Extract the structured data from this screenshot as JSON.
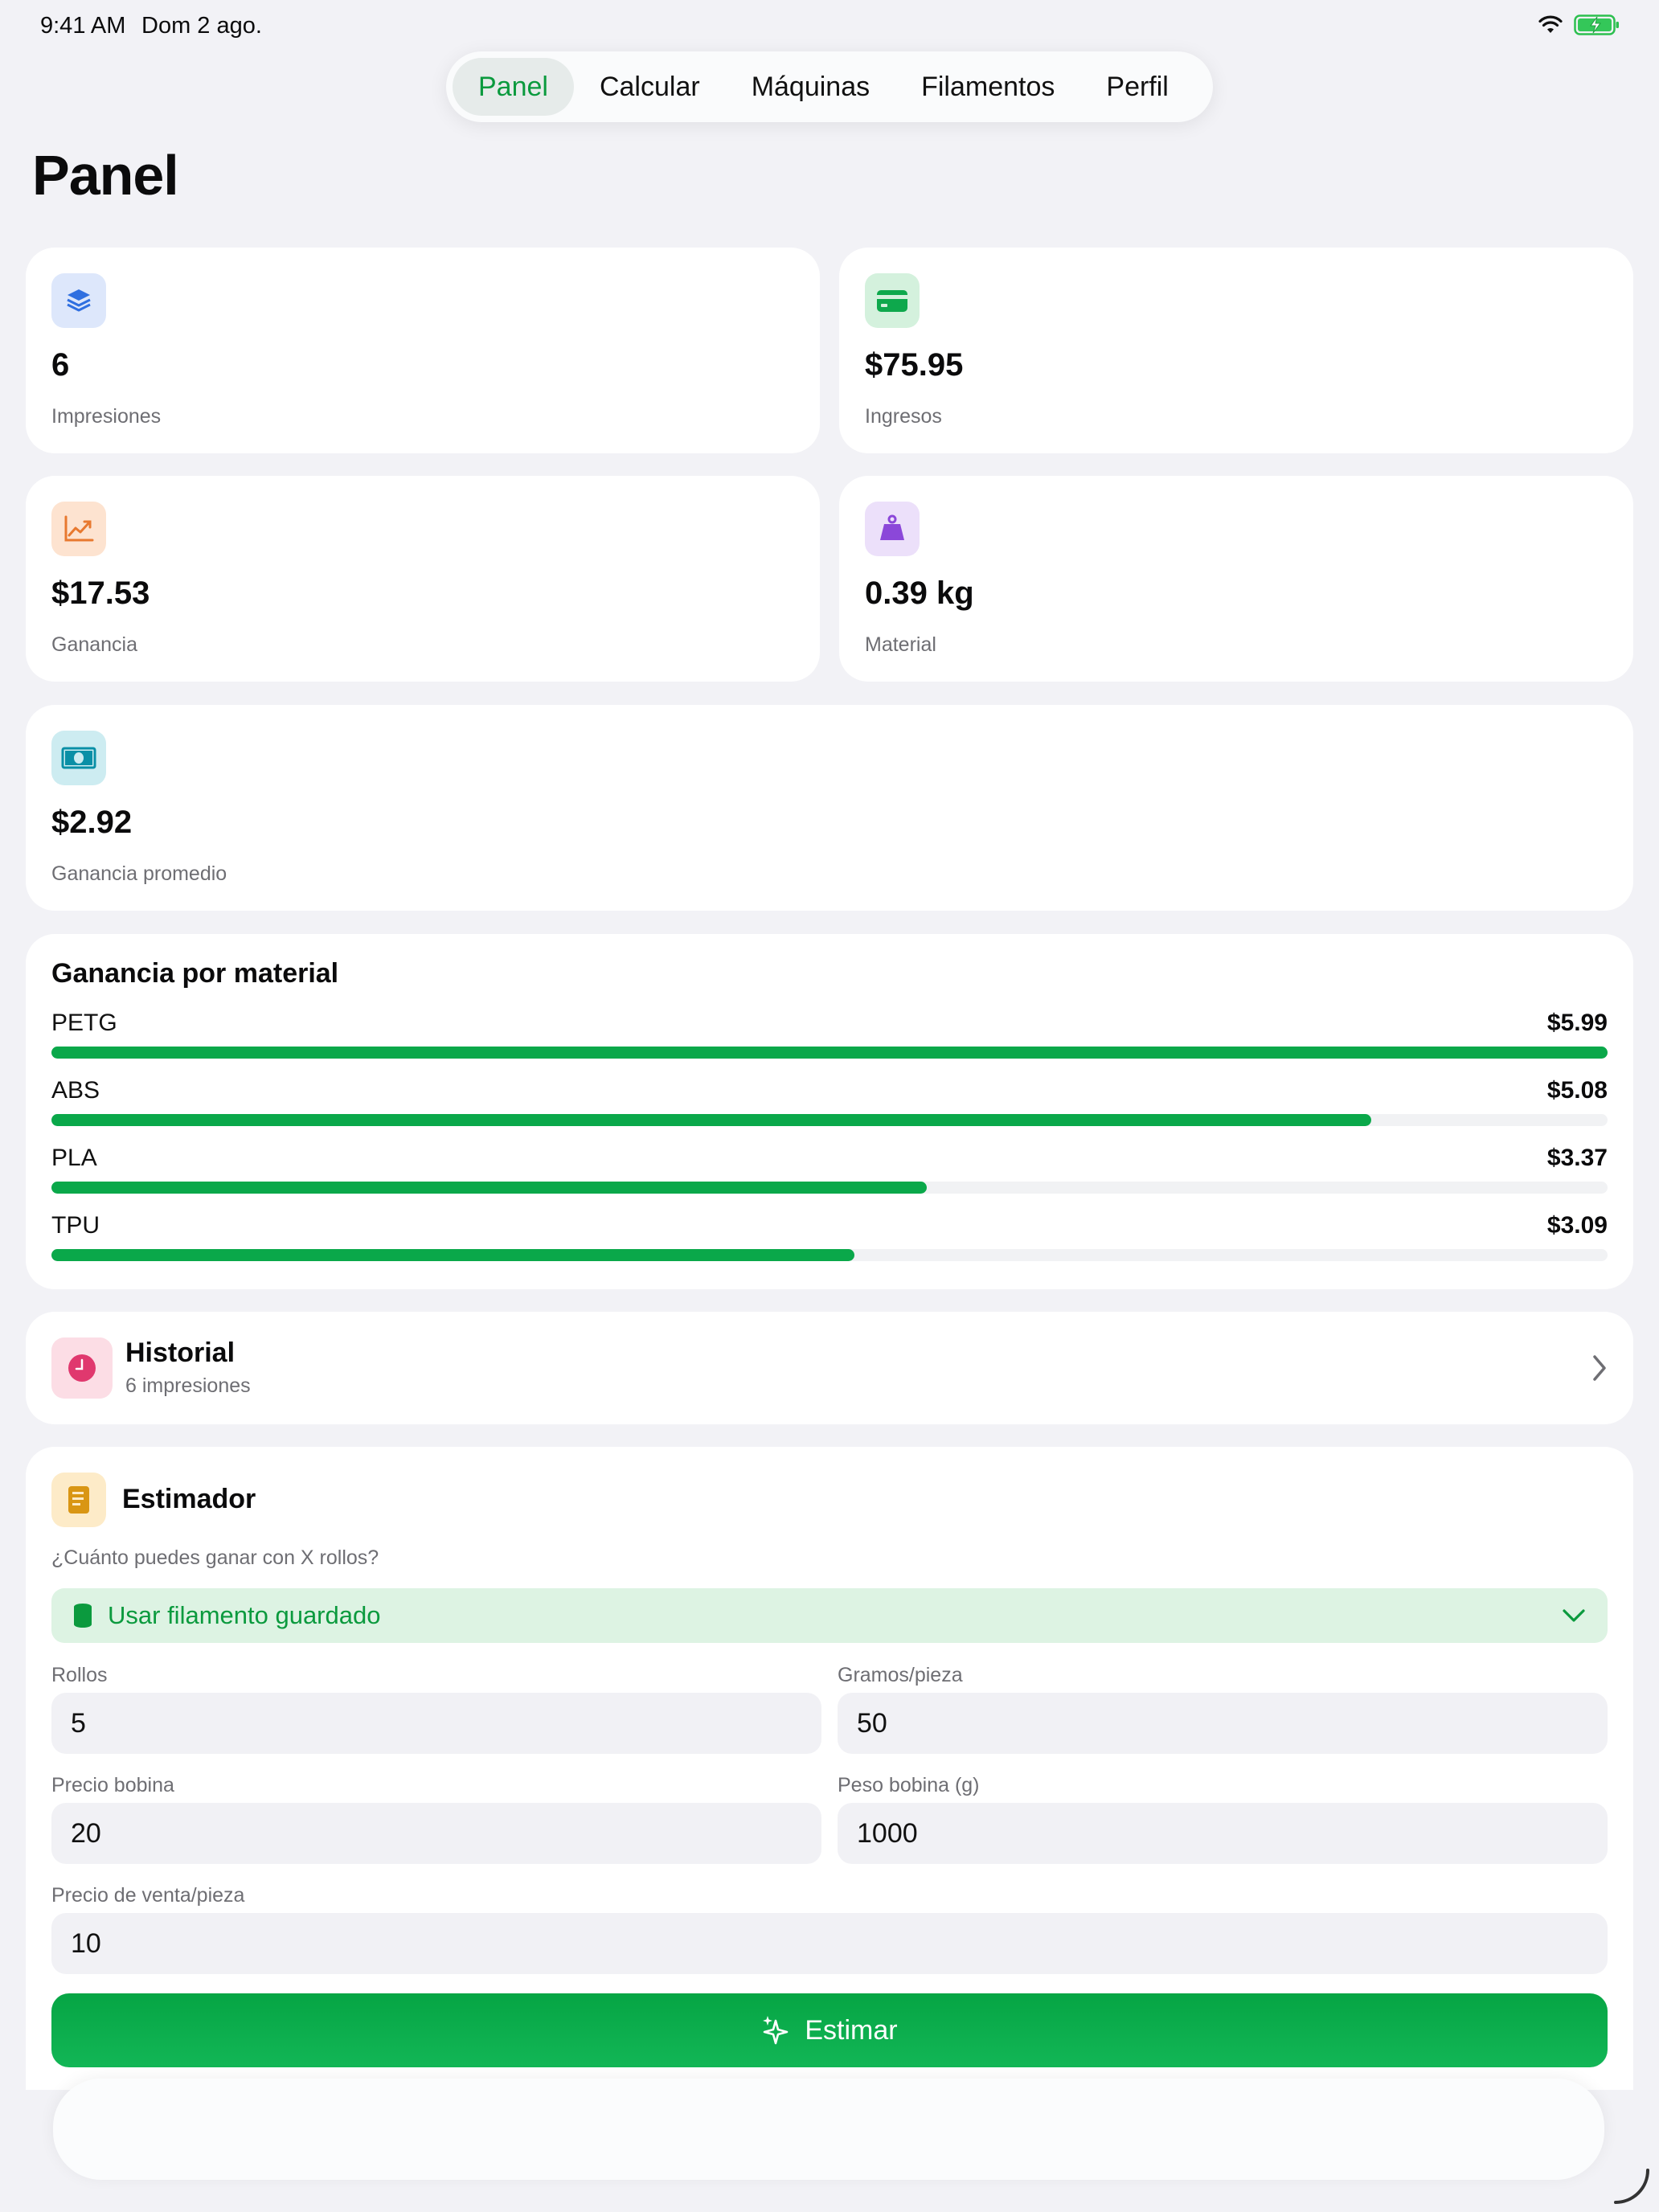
{
  "status": {
    "time": "9:41 AM",
    "date": "Dom 2 ago."
  },
  "tabs": [
    "Panel",
    "Calcular",
    "Máquinas",
    "Filamentos",
    "Perfil"
  ],
  "title": "Panel",
  "stats": {
    "prints": {
      "value": "6",
      "label": "Impresiones",
      "icon": "layers-icon"
    },
    "income": {
      "value": "$75.95",
      "label": "Ingresos",
      "icon": "credit-card-icon"
    },
    "profit": {
      "value": "$17.53",
      "label": "Ganancia",
      "icon": "chart-line-icon"
    },
    "material": {
      "value": "0.39 kg",
      "label": "Material",
      "icon": "weight-icon"
    },
    "avg_profit": {
      "value": "$2.92",
      "label": "Ganancia promedio",
      "icon": "banknote-icon"
    }
  },
  "profit_by_material": {
    "title": "Ganancia por material",
    "items": [
      {
        "name": "PETG",
        "value": "$5.99",
        "amount": 5.99
      },
      {
        "name": "ABS",
        "value": "$5.08",
        "amount": 5.08
      },
      {
        "name": "PLA",
        "value": "$3.37",
        "amount": 3.37
      },
      {
        "name": "TPU",
        "value": "$3.09",
        "amount": 3.09
      }
    ]
  },
  "history": {
    "title": "Historial",
    "subtitle": "6 impresiones"
  },
  "estimator": {
    "title": "Estimador",
    "question": "¿Cuánto puedes ganar con X rollos?",
    "filament_select": "Usar filamento guardado",
    "fields": {
      "rolls": {
        "label": "Rollos",
        "value": "5"
      },
      "grams": {
        "label": "Gramos/pieza",
        "value": "50"
      },
      "spool_price": {
        "label": "Precio bobina",
        "value": "20"
      },
      "spool_weight": {
        "label": "Peso bobina (g)",
        "value": "1000"
      },
      "sale_price": {
        "label": "Precio de venta/pieza",
        "value": "10"
      }
    },
    "button": "Estimar"
  },
  "colors": {
    "accent": "#0aa84a",
    "background": "#f2f2f6"
  }
}
